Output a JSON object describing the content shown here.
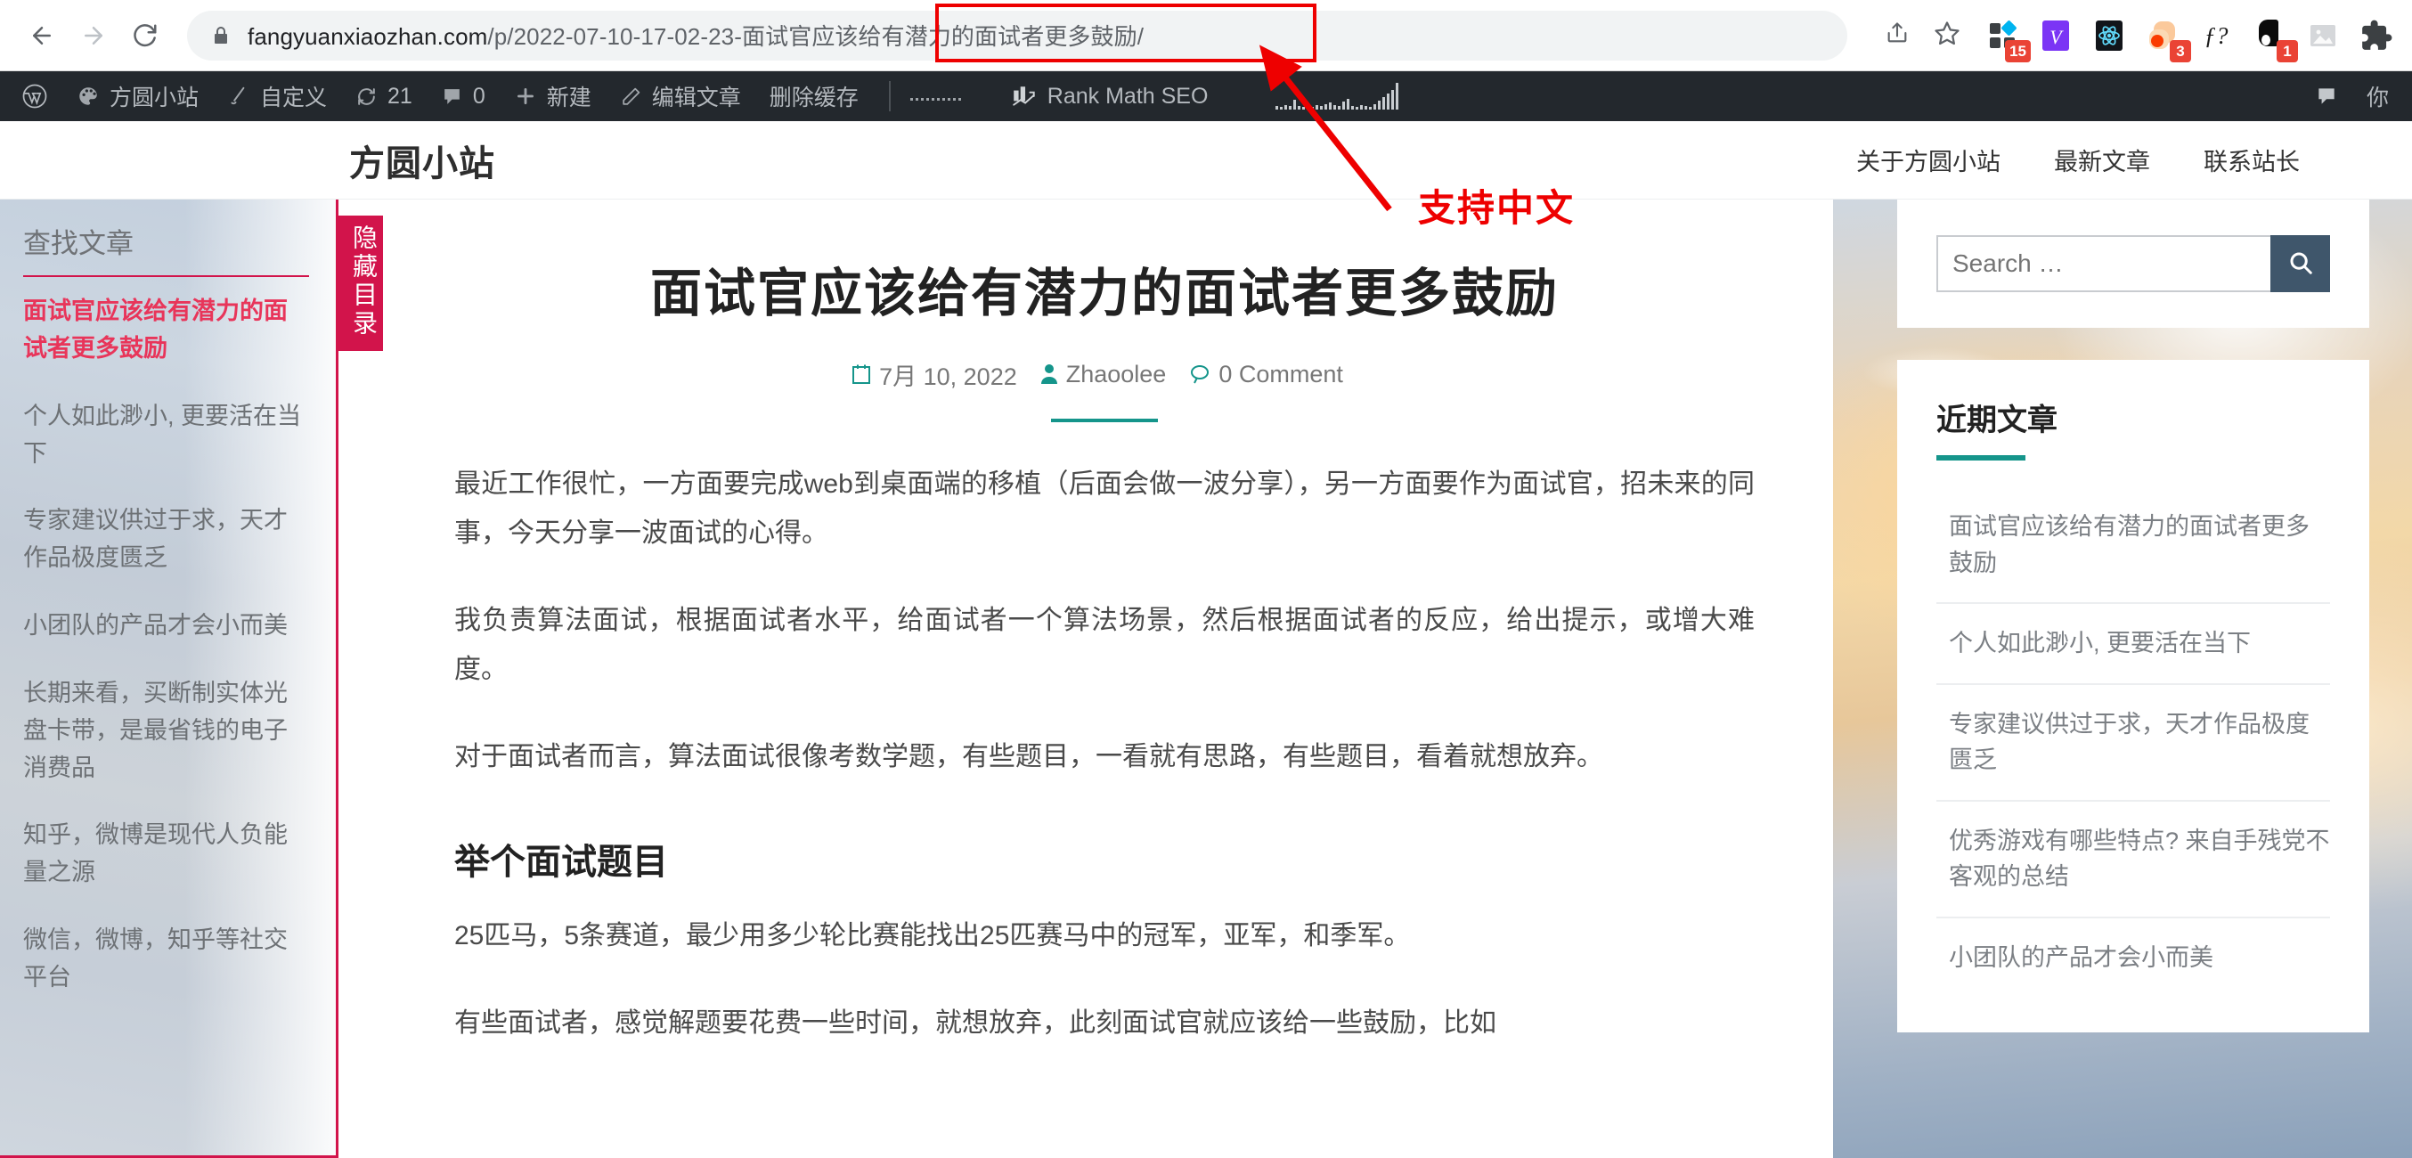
{
  "browser": {
    "back_icon": "back-arrow-icon",
    "forward_icon": "forward-arrow-icon",
    "reload_icon": "reload-icon",
    "lock_icon": "lock-icon",
    "url_domain": "fangyuanxiaozhan.com",
    "url_path": "/p/2022-07-10-17-02-23-",
    "url_chinese": "面试官应该给有潜力的面试者更多鼓励/",
    "url_full": "fangyuanxiaozhan.com/p/2022-07-10-17-02-23-面试官应该给有潜力的面试者更多鼓励/",
    "share_label": "share-icon",
    "bookmark_label": "star-icon",
    "highlight_color": "#ee0000",
    "extensions": [
      {
        "name": "grid-diamond-extension-icon",
        "badge": "15"
      },
      {
        "name": "vimium-v-extension-icon",
        "badge": ""
      },
      {
        "name": "react-devtools-extension-icon",
        "badge": ""
      },
      {
        "name": "peach-blob-extension-icon",
        "badge": "3"
      },
      {
        "name": "f-question-extension-icon",
        "badge": ""
      },
      {
        "name": "black-blob-extension-icon",
        "badge": "1"
      },
      {
        "name": "image-placeholder-extension-icon",
        "badge": ""
      },
      {
        "name": "puzzle-extensions-icon",
        "badge": ""
      }
    ]
  },
  "adminbar": {
    "wp_logo": "wordpress-logo-icon",
    "items": [
      {
        "icon": "dashboard-icon",
        "label": "方圆小站"
      },
      {
        "icon": "brush-icon",
        "label": "自定义"
      },
      {
        "icon": "updates-icon",
        "label": "21"
      },
      {
        "icon": "comment-bubble-icon",
        "label": "0"
      },
      {
        "icon": "plus-icon",
        "label": "新建"
      },
      {
        "icon": "pencil-icon",
        "label": "编辑文章"
      },
      {
        "icon": "",
        "label": "删除缓存"
      }
    ],
    "seo_icon": "bar-chart-icon",
    "seo_label": "Rank Math SEO",
    "right_icon": "comment-bubble-icon",
    "right_label": "你"
  },
  "site": {
    "title": "方圆小站",
    "nav": [
      {
        "label": "关于方圆小站"
      },
      {
        "label": "最新文章"
      },
      {
        "label": "联系站长"
      }
    ]
  },
  "toc": {
    "heading": "查找文章",
    "toggle_label": "隐藏目录",
    "items": [
      {
        "label": "面试官应该给有潜力的面试者更多鼓励",
        "active": true
      },
      {
        "label": "个人如此渺小, 更要活在当下",
        "active": false
      },
      {
        "label": "专家建议供过于求，天才作品极度匮乏",
        "active": false
      },
      {
        "label": "小团队的产品才会小而美",
        "active": false
      },
      {
        "label": "长期来看，买断制实体光盘卡带，是最省钱的电子消费品",
        "active": false
      },
      {
        "label": "知乎，微博是现代人负能量之源",
        "active": false
      },
      {
        "label": "微信，微博，知乎等社交平台",
        "active": false
      }
    ]
  },
  "article": {
    "title": "面试官应该给有潜力的面试者更多鼓励",
    "date_icon": "calendar-icon",
    "date": "7月 10, 2022",
    "author_icon": "user-icon",
    "author": "Zhaoolee",
    "comment_icon": "comment-icon",
    "comments": "0 Comment",
    "paragraphs": [
      "最近工作很忙，一方面要完成web到桌面端的移植（后面会做一波分享），另一方面要作为面试官，招未来的同事，今天分享一波面试的心得。",
      "我负责算法面试，根据面试者水平，给面试者一个算法场景，然后根据面试者的反应，给出提示，或增大难度。",
      "对于面试者而言，算法面试很像考数学题，有些题目，一看就有思路，有些题目，看着就想放弃。"
    ],
    "section_heading": "举个面试题目",
    "section_paragraph": "25匹马，5条赛道，最少用多少轮比赛能找出25匹赛马中的冠军，亚军，和季军。",
    "section_paragraph_2": "有些面试者，感觉解题要花费一些时间，就想放弃，此刻面试官就应该给一些鼓励，比如"
  },
  "widgets": {
    "search": {
      "placeholder": "Search …",
      "value": "",
      "button_icon": "search-icon"
    },
    "recent": {
      "title": "近期文章",
      "items": [
        {
          "label": "面试官应该给有潜力的面试者更多鼓励"
        },
        {
          "label": "个人如此渺小, 更要活在当下"
        },
        {
          "label": "专家建议供过于求，天才作品极度匮乏"
        },
        {
          "label": "优秀游戏有哪些特点? 来自手残党不客观的总结"
        },
        {
          "label": "小团队的产品才会小而美"
        }
      ]
    }
  },
  "annotation": {
    "label": "支持中文",
    "color": "#ee0000"
  }
}
